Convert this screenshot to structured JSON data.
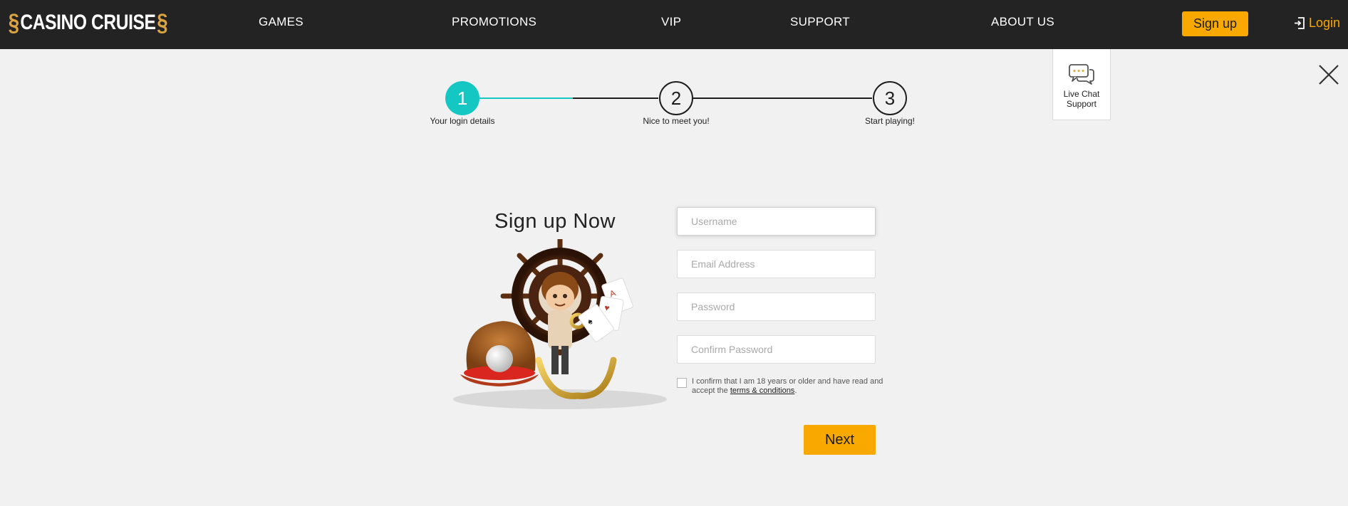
{
  "header": {
    "logo_text": "CASINO CRUISE",
    "nav": [
      "GAMES",
      "PROMOTIONS",
      "VIP",
      "SUPPORT",
      "ABOUT US"
    ],
    "signup_label": "Sign up",
    "login_label": "Login",
    "accent_color": "#f9a800",
    "background": "#232323"
  },
  "stepper": {
    "active_color": "#14c7c3",
    "current_step": 1,
    "steps": [
      {
        "number": "1",
        "label": "Your login details"
      },
      {
        "number": "2",
        "label": "Nice to meet you!"
      },
      {
        "number": "3",
        "label": "Start playing!"
      }
    ]
  },
  "live_chat": {
    "label": "Live Chat Support",
    "icon": "chat-bubbles-icon"
  },
  "close_icon": "close-icon",
  "form": {
    "title": "Sign up Now",
    "username_placeholder": "Username",
    "email_placeholder": "Email Address",
    "password_placeholder": "Password",
    "confirm_placeholder": "Confirm Password",
    "terms_text": "I confirm that I am 18 years or older and have read and accept the",
    "terms_link": "terms & conditions",
    "terms_suffix": ".",
    "next_label": "Next"
  }
}
